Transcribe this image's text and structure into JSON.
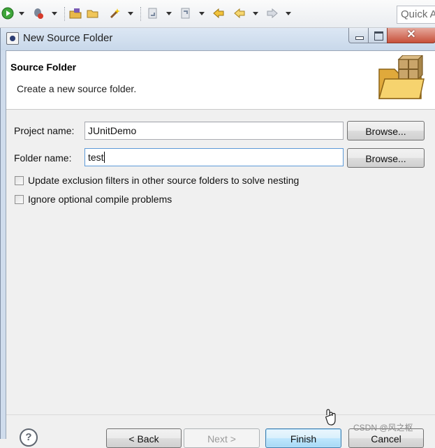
{
  "toolbar": {
    "icons": [
      "run-icon",
      "debug-icon",
      "new-package-icon",
      "open-folder-icon",
      "wand-icon",
      "next-annotation-icon",
      "previous-annotation-icon",
      "last-edit-icon",
      "back-icon",
      "forward-icon"
    ],
    "quick_access": "Quick A"
  },
  "window": {
    "title": "New Source Folder",
    "close_glyph": "✕"
  },
  "header": {
    "title": "Source Folder",
    "description": "Create a new source folder."
  },
  "form": {
    "project_label": "Project name:",
    "project_value": "JUnitDemo",
    "project_browse": "Browse...",
    "folder_label": "Folder name:",
    "folder_value": "test",
    "folder_browse": "Browse...",
    "option1": {
      "label": "Update exclusion filters in other source folders to solve nesting",
      "checked": false
    },
    "option2": {
      "label": "Ignore optional compile problems",
      "checked": false
    }
  },
  "footer": {
    "help": "?",
    "back": "< Back",
    "next": "Next >",
    "finish": "Finish",
    "cancel": "Cancel"
  },
  "watermark": "CSDN @风之枢"
}
